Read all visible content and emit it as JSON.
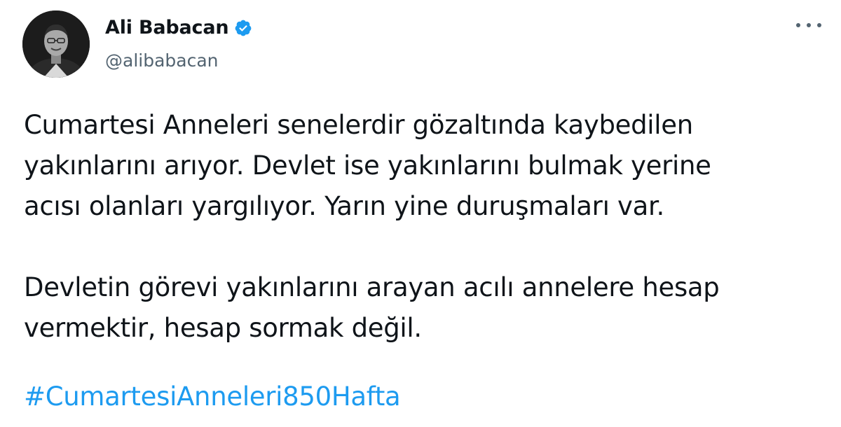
{
  "author": {
    "display_name": "Ali Babacan",
    "handle": "@alibabacan",
    "verified": true,
    "avatar_icon": "profile-photo"
  },
  "menu": {
    "icon": "more-horizontal-icon"
  },
  "tweet": {
    "paragraph1": "Cumartesi Anneleri senelerdir gözaltında kaybedilen\nyakınlarını arıyor. Devlet ise yakınlarını bulmak yerine\nacısı olanları yargılıyor. Yarın yine duruşmaları var.",
    "paragraph2": "Devletin görevi yakınlarını arayan acılı annelere hesap\nvermektir, hesap sormak değil.",
    "hashtag": "#CumartesiAnneleri850Hafta"
  },
  "colors": {
    "text": "#0f1419",
    "secondary": "#536471",
    "link": "#1d9bf0",
    "verified_badge": "#1d9bf0"
  }
}
